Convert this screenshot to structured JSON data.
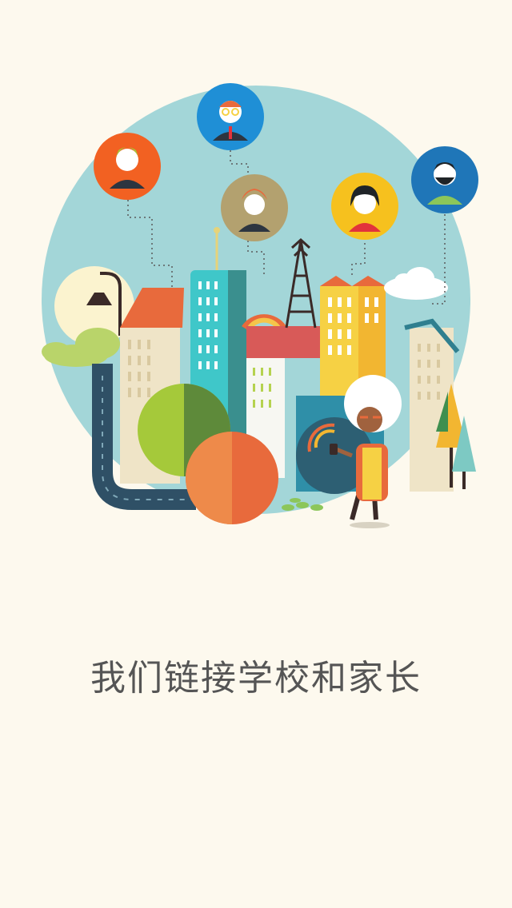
{
  "splash": {
    "tagline": "我们链接学校和家长"
  },
  "colors": {
    "background": "#fdf9ee",
    "circle": "#a3d6d8",
    "text": "#555555"
  },
  "icons": [
    "avatar-green-hair-woman-icon",
    "avatar-glasses-man-icon",
    "avatar-red-hair-woman-icon",
    "avatar-black-hair-woman-icon",
    "avatar-bearded-man-icon",
    "elderly-woman-phone-icon"
  ]
}
